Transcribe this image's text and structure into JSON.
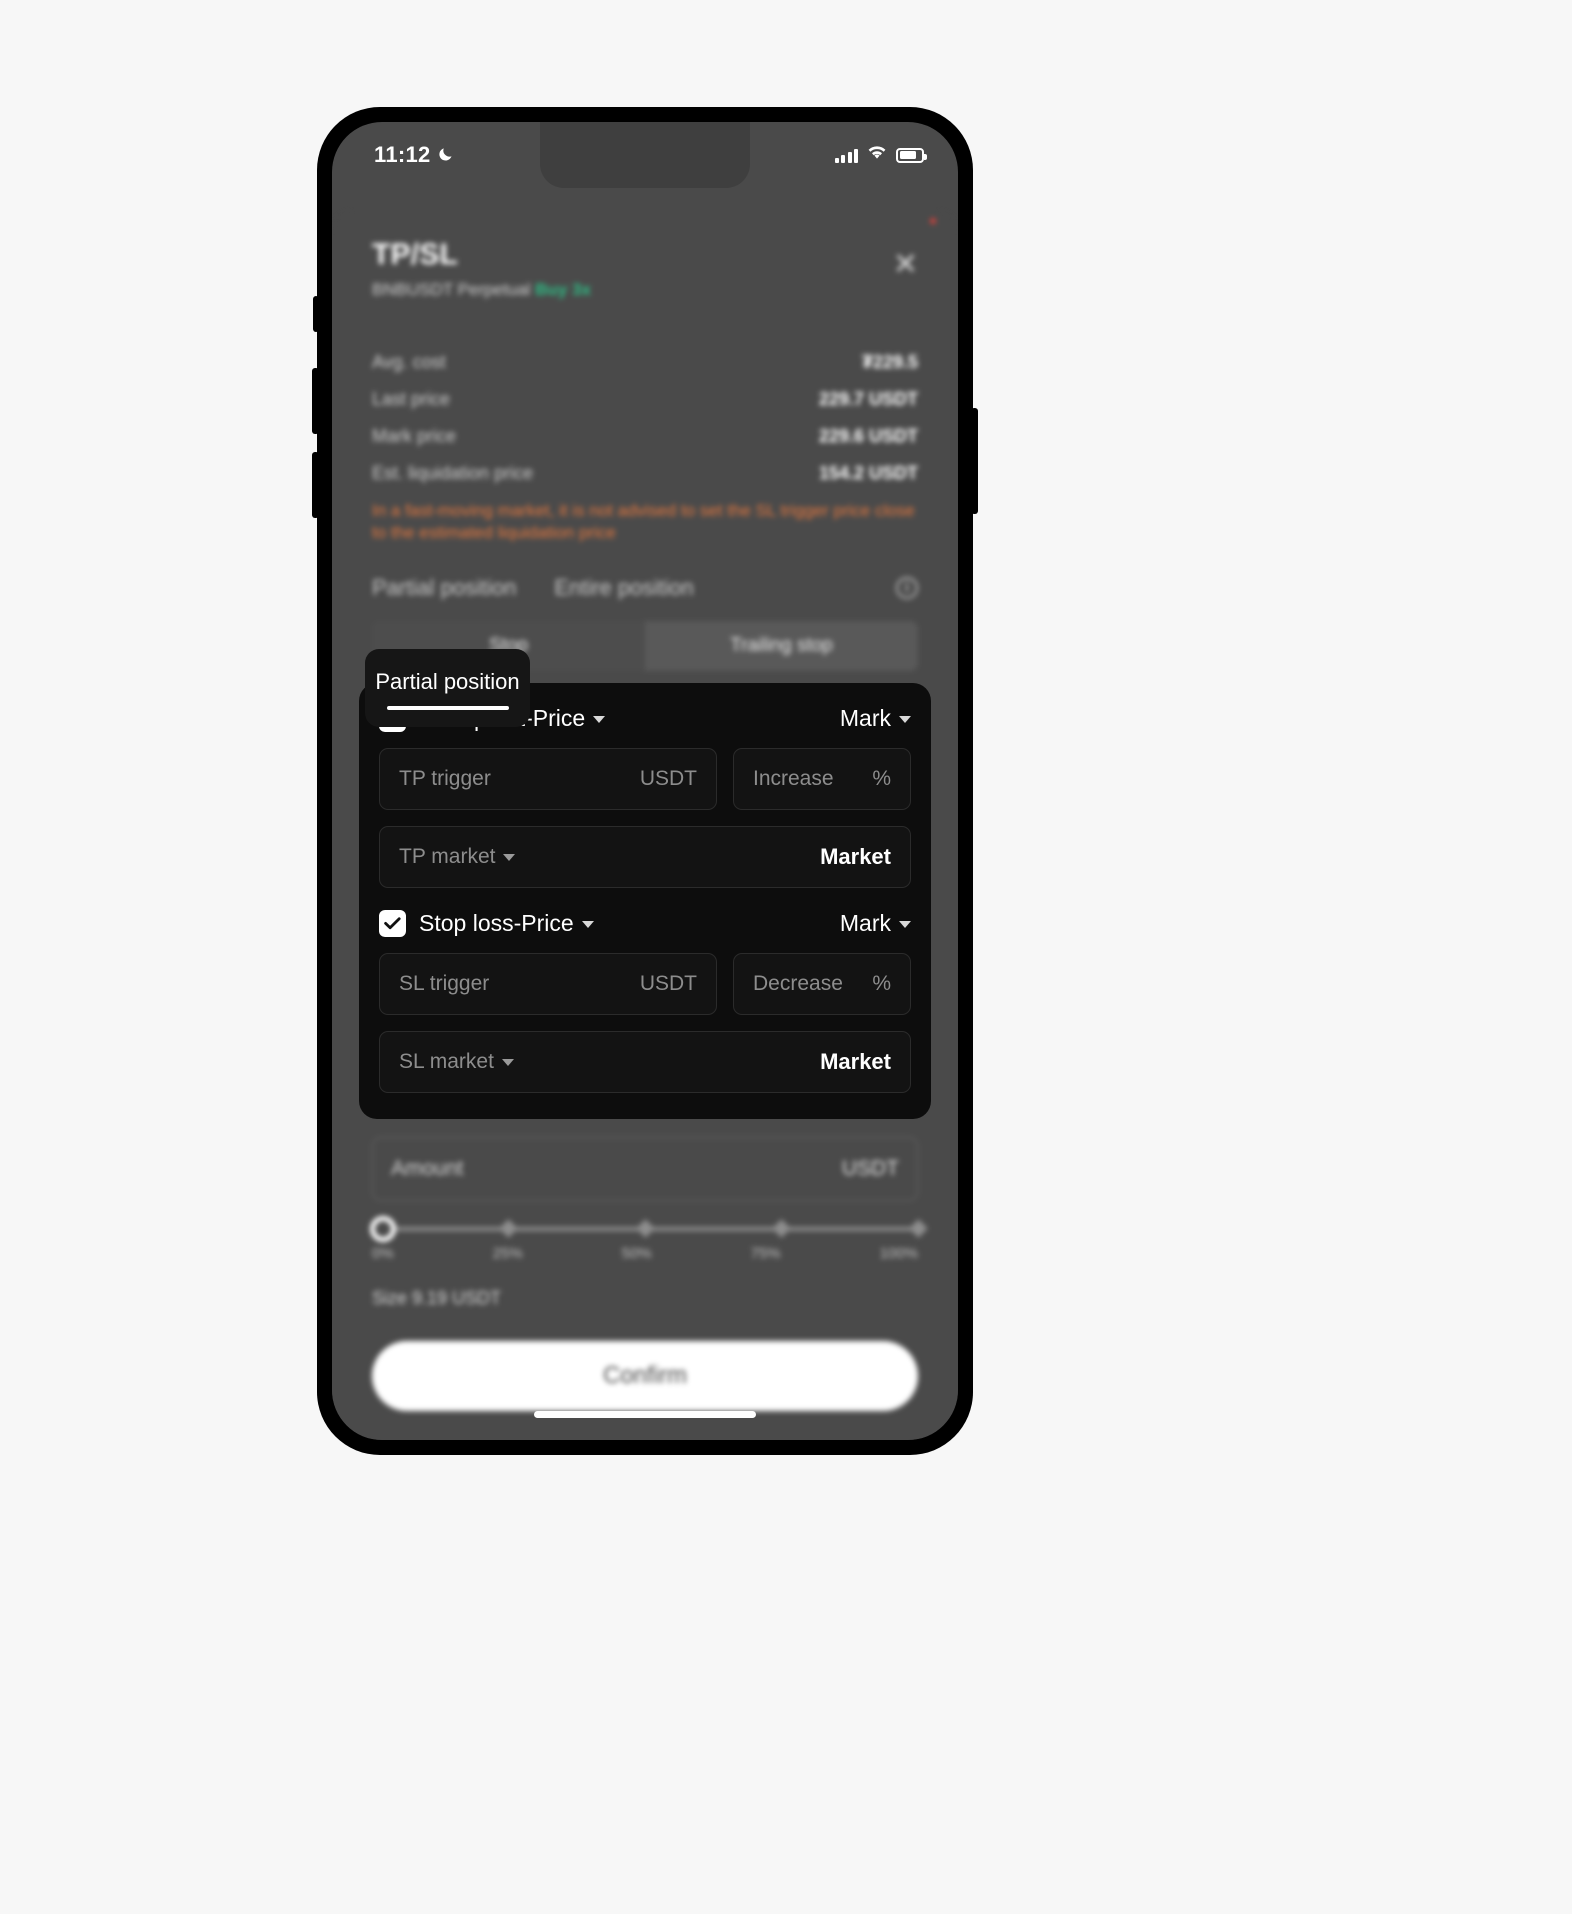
{
  "status_bar": {
    "time": "11:12",
    "moon_icon": "crescent-moon-icon",
    "signal_icon": "signal-bars-icon",
    "wifi_icon": "wifi-icon",
    "battery_icon": "battery-icon"
  },
  "sheet": {
    "title": "TP/SL",
    "subtitle_pair": "BNBUSDT Perpetual",
    "subtitle_side": "Buy 3x",
    "close_icon": "close-icon"
  },
  "info": {
    "rows": [
      {
        "label": "Avg. cost",
        "value": "₮229.5"
      },
      {
        "label": "Last price",
        "value": "229.7 USDT"
      },
      {
        "label": "Mark price",
        "value": "229.6 USDT"
      },
      {
        "label": "Est. liquidation price",
        "value": "154.2 USDT"
      }
    ],
    "warning": "In a fast-moving market, it is not advised to set the SL trigger price close to the estimated liquidation price",
    "warning_color": "#e8793f"
  },
  "position_tabs": {
    "items": [
      {
        "label": "Partial position",
        "selected": true
      },
      {
        "label": "Entire position",
        "selected": false
      }
    ],
    "info_icon": "info-circle-icon"
  },
  "stop_segment": {
    "items": [
      {
        "label": "Stop",
        "selected": true
      },
      {
        "label": "Trailing stop",
        "selected": false
      }
    ]
  },
  "take_profit": {
    "checked": true,
    "title": "Take profit-Price",
    "price_source": "Mark",
    "trigger_placeholder": "TP trigger",
    "trigger_suffix": "USDT",
    "pct_placeholder": "Increase",
    "pct_suffix": "%",
    "order_type_label": "TP market",
    "order_type_value": "Market"
  },
  "stop_loss": {
    "checked": true,
    "title": "Stop loss-Price",
    "price_source": "Mark",
    "trigger_placeholder": "SL trigger",
    "trigger_suffix": "USDT",
    "pct_placeholder": "Decrease",
    "pct_suffix": "%",
    "order_type_label": "SL market",
    "order_type_value": "Market"
  },
  "amount": {
    "placeholder": "Amount",
    "suffix": "USDT",
    "slider_value_pct": 0,
    "slider_labels": [
      "0%",
      "25%",
      "50%",
      "75%",
      "100%"
    ],
    "size_text": "Size 9.19 USDT"
  },
  "confirm": {
    "label": "Confirm"
  },
  "colors": {
    "accent_green": "#2ebd85",
    "warning_orange": "#e8793f",
    "screen_bg": "#4a4a4a",
    "card_bg": "#0d0d0d"
  }
}
